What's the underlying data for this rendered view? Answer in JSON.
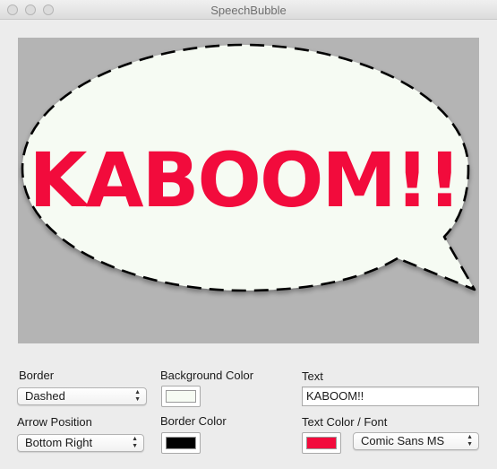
{
  "window": {
    "title": "SpeechBubble"
  },
  "bubble": {
    "text": "KABOOM!!",
    "background_color": "#f6fbf3",
    "border_color": "#000000",
    "text_color": "#f20b3c"
  },
  "controls": {
    "border": {
      "label": "Border",
      "value": "Dashed"
    },
    "arrow_position": {
      "label": "Arrow Position",
      "value": "Bottom Right"
    },
    "background_color": {
      "label": "Background Color",
      "value": "#f6fbf3"
    },
    "border_color": {
      "label": "Border Color",
      "value": "#000000"
    },
    "text": {
      "label": "Text",
      "value": "KABOOM!!"
    },
    "text_color_font": {
      "label": "Text Color / Font",
      "color": "#f20b3c",
      "font": "Comic Sans MS"
    }
  }
}
